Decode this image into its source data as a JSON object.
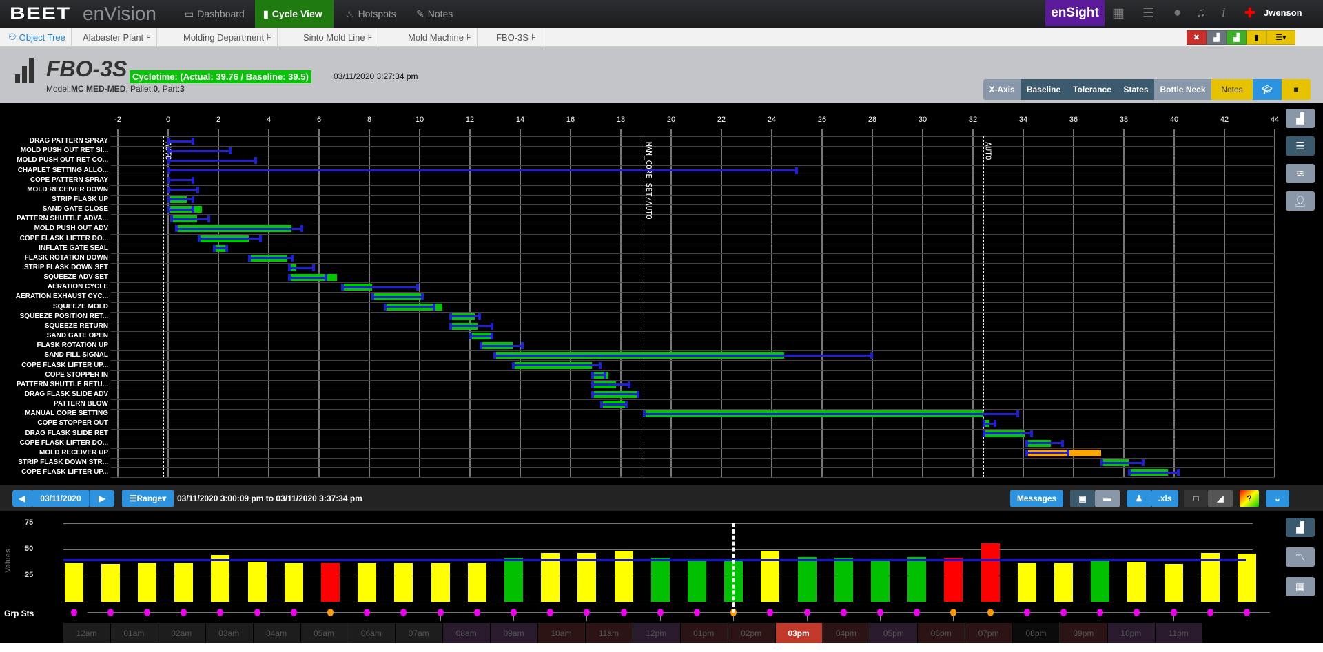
{
  "nav": {
    "logo_brand": "BEET",
    "logo_product": "enVision",
    "tabs": [
      {
        "label": "Dashboard",
        "icon": "monitor-icon"
      },
      {
        "label": "Cycle View",
        "icon": "bar-chart-icon",
        "active": true
      },
      {
        "label": "Hotspots",
        "icon": "fire-icon"
      },
      {
        "label": "Notes",
        "icon": "edit-icon"
      }
    ],
    "ensight": "enSight",
    "user": "Jwenson"
  },
  "breadcrumb": [
    "Object Tree",
    "Alabaster Plant",
    "Molding Department",
    "Sinto Mold Line",
    "Mold Machine",
    "FBO-3S"
  ],
  "header": {
    "title": "FBO-3S",
    "cycletime": "Cycletime: (Actual: 39.76 / Baseline: 39.5)",
    "timestamp": "03/11/2020 3:27:34 pm",
    "model_label": "Model:",
    "model": "MC MED-MED",
    "pallet_label": ", Pallet:",
    "pallet": "0",
    "part_label": ", Part:",
    "part": "3",
    "buttons": [
      "X-Axis",
      "Baseline",
      "Tolerance",
      "States",
      "Bottle Neck",
      "Notes"
    ]
  },
  "colors": {
    "actual": "#00c800",
    "baseline": "#2020d0",
    "over": "#ffa500",
    "yellow": "#ffff00",
    "green": "#00c000",
    "red": "#ff0000",
    "active_tab": "#1f7a10",
    "ensight": "#5b1a99"
  },
  "chart_data": [
    {
      "type": "gantt",
      "xlim": [
        -2,
        44
      ],
      "xticks": [
        -2,
        0,
        2,
        4,
        6,
        8,
        10,
        12,
        14,
        16,
        18,
        20,
        22,
        24,
        26,
        28,
        30,
        32,
        34,
        36,
        38,
        40,
        42,
        44
      ],
      "markers": [
        {
          "x": -0.2,
          "label": "AUTO"
        },
        {
          "x": 18.9,
          "label": "MAN_CORE SET/AUTO"
        },
        {
          "x": 32.4,
          "label": "AUTO"
        }
      ],
      "rows": [
        {
          "label": "DRAG PATTERN SPRAY",
          "baseline": [
            0,
            1.0
          ]
        },
        {
          "label": "MOLD PUSH OUT RET SI...",
          "baseline": [
            0,
            2.5
          ]
        },
        {
          "label": "MOLD PUSH OUT RET CO...",
          "baseline": [
            0,
            3.5
          ]
        },
        {
          "label": "CHAPLET SETTING ALLO...",
          "baseline": [
            0,
            25.0
          ]
        },
        {
          "label": "COPE PATTERN SPRAY",
          "baseline": [
            0,
            1.0
          ]
        },
        {
          "label": "MOLD RECEIVER DOWN",
          "baseline": [
            0,
            1.2
          ]
        },
        {
          "label": "STRIP FLASK UP",
          "actual": [
            0,
            0.75
          ],
          "baseline": [
            0,
            1.0
          ]
        },
        {
          "label": "SAND GATE CLOSE",
          "actual": [
            0,
            1.35
          ],
          "baseline": [
            0,
            1.0
          ]
        },
        {
          "label": "PATTERN SHUTTLE ADVA...",
          "actual": [
            0.1,
            1.15
          ],
          "baseline": [
            0.1,
            1.65
          ]
        },
        {
          "label": "MOLD PUSH OUT ADV",
          "actual": [
            0.3,
            4.9
          ],
          "baseline": [
            0.3,
            5.35
          ]
        },
        {
          "label": "COPE FLASK LIFTER DO...",
          "actual": [
            1.2,
            3.2
          ],
          "baseline": [
            1.2,
            3.7
          ]
        },
        {
          "label": "INFLATE GATE SEAL",
          "actual": [
            1.85,
            2.3
          ],
          "baseline": [
            1.8,
            2.35
          ]
        },
        {
          "label": "FLASK ROTATION DOWN",
          "actual": [
            3.2,
            4.75
          ],
          "baseline": [
            3.2,
            4.95
          ]
        },
        {
          "label": "STRIP FLASK DOWN SET",
          "actual": [
            4.8,
            5.1
          ],
          "baseline": [
            4.8,
            5.8
          ]
        },
        {
          "label": "SQUEEZE ADV SET",
          "actual": [
            4.8,
            6.7
          ],
          "baseline": [
            4.8,
            6.3
          ]
        },
        {
          "label": "AERATION CYCLE",
          "actual": [
            6.9,
            8.1
          ],
          "baseline": [
            6.9,
            9.95
          ]
        },
        {
          "label": "AERATION EXHAUST CYC...",
          "actual": [
            8.1,
            10.15
          ],
          "baseline": [
            8.1,
            10.15
          ]
        },
        {
          "label": "SQUEEZE MOLD",
          "actual": [
            8.6,
            10.9
          ],
          "baseline": [
            8.6,
            10.6
          ]
        },
        {
          "label": "SQUEEZE POSITION RET...",
          "actual": [
            11.2,
            12.2
          ],
          "baseline": [
            11.2,
            12.4
          ]
        },
        {
          "label": "SQUEEZE RETURN",
          "actual": [
            11.2,
            12.3
          ],
          "baseline": [
            11.2,
            12.9
          ]
        },
        {
          "label": "SAND GATE OPEN",
          "actual": [
            12.0,
            12.9
          ],
          "baseline": [
            12.0,
            12.9
          ]
        },
        {
          "label": "FLASK ROTATION UP",
          "actual": [
            12.4,
            13.7
          ],
          "baseline": [
            12.4,
            14.1
          ]
        },
        {
          "label": "SAND FILL SIGNAL",
          "actual": [
            12.95,
            24.5
          ],
          "baseline": [
            12.95,
            28.0
          ]
        },
        {
          "label": "COPE FLASK LIFTER UP...",
          "actual": [
            13.7,
            16.85
          ],
          "baseline": [
            13.7,
            17.2
          ]
        },
        {
          "label": "COPE STOPPER IN",
          "actual": [
            16.85,
            17.5
          ],
          "baseline": [
            16.85,
            17.4
          ]
        },
        {
          "label": "PATTERN SHUTTLE RETU...",
          "actual": [
            16.85,
            17.8
          ],
          "baseline": [
            16.85,
            18.35
          ]
        },
        {
          "label": "DRAG FLASK SLIDE ADV",
          "actual": [
            16.85,
            18.7
          ],
          "baseline": [
            16.85,
            18.7
          ]
        },
        {
          "label": "PATTERN BLOW",
          "actual": [
            17.2,
            18.2
          ],
          "baseline": [
            17.2,
            18.25
          ]
        },
        {
          "label": "MANUAL CORE SETTING",
          "actual": [
            18.9,
            32.4
          ],
          "baseline": [
            18.9,
            33.8
          ]
        },
        {
          "label": "COPE STOPPER OUT",
          "actual": [
            32.4,
            32.65
          ],
          "baseline": [
            32.4,
            32.9
          ]
        },
        {
          "label": "DRAG FLASK SLIDE RET",
          "actual": [
            32.4,
            34.05
          ],
          "baseline": [
            32.4,
            34.35
          ]
        },
        {
          "label": "COPE FLASK LIFTER DO...",
          "actual": [
            34.1,
            35.1
          ],
          "baseline": [
            34.1,
            35.6
          ]
        },
        {
          "label": "MOLD RECEIVER UP",
          "actual": [
            34.1,
            37.1
          ],
          "baseline": [
            34.1,
            35.8
          ],
          "status": "over"
        },
        {
          "label": "STRIP FLASK DOWN STR...",
          "actual": [
            37.1,
            38.2
          ],
          "baseline": [
            37.1,
            38.8
          ]
        },
        {
          "label": "COPE FLASK LIFTER UP...",
          "actual": [
            38.2,
            39.75
          ],
          "baseline": [
            38.2,
            40.2
          ]
        }
      ]
    },
    {
      "type": "bar",
      "ylabel": "Values",
      "ylim": [
        0,
        75
      ],
      "yticks": [
        25,
        50,
        75
      ],
      "baseline": 40,
      "status_label": "Grp Sts",
      "selected_index": 18,
      "values": [
        37,
        36,
        37,
        37,
        45,
        38,
        37,
        37,
        37,
        37,
        37,
        37,
        42,
        47,
        47,
        49,
        42,
        40,
        40,
        49,
        43,
        42,
        41,
        43,
        42,
        56,
        37,
        37,
        40,
        38,
        36,
        47,
        46
      ],
      "colors": [
        "yellow",
        "yellow",
        "yellow",
        "yellow",
        "yellow",
        "yellow",
        "yellow",
        "red",
        "yellow",
        "yellow",
        "yellow",
        "yellow",
        "green",
        "yellow",
        "yellow",
        "yellow",
        "green",
        "green",
        "green",
        "yellow",
        "green",
        "green",
        "green",
        "green",
        "red",
        "red",
        "yellow",
        "yellow",
        "green",
        "yellow",
        "yellow",
        "yellow",
        "yellow"
      ],
      "status_dots": [
        "m",
        "m",
        "m",
        "m",
        "m",
        "m",
        "m",
        "o",
        "m",
        "m",
        "m",
        "m",
        "m",
        "m",
        "m",
        "m",
        "m",
        "m",
        "o",
        "m",
        "m",
        "m",
        "m",
        "m",
        "o",
        "o",
        "m",
        "m",
        "m",
        "m",
        "m",
        "m",
        "m"
      ]
    }
  ],
  "controls": {
    "date": "03/11/2020",
    "range_label": "Range",
    "range_text": "03/11/2020 3:00:09 pm to 03/11/2020 3:37:34 pm",
    "messages": "Messages",
    "xls": ".xls"
  },
  "timeline": {
    "hours": [
      "12am",
      "01am",
      "02am",
      "03am",
      "04am",
      "05am",
      "06am",
      "07am",
      "08am",
      "09am",
      "10am",
      "11am",
      "12pm",
      "01pm",
      "02pm",
      "03pm",
      "04pm",
      "05pm",
      "06pm",
      "07pm",
      "08pm",
      "09pm",
      "10pm",
      "11pm"
    ],
    "states": [
      "n",
      "n",
      "n",
      "n",
      "n",
      "n",
      "n",
      "n",
      "p",
      "p",
      "r",
      "r",
      "p",
      "r",
      "r",
      "a",
      "r",
      "p",
      "r",
      "r",
      "k",
      "r",
      "p",
      "p"
    ]
  }
}
